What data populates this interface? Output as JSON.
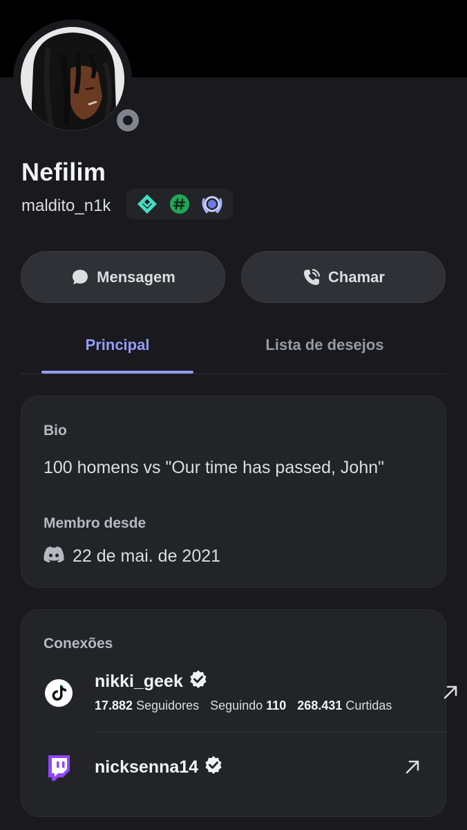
{
  "profile": {
    "display_name": "Nefilim",
    "username": "maldito_n1k",
    "status": "offline",
    "badges": [
      "hypesquad-balance-icon",
      "active-developer-icon",
      "quest-badge-icon"
    ]
  },
  "actions": {
    "message_label": "Mensagem",
    "call_label": "Chamar"
  },
  "tabs": [
    {
      "label": "Principal",
      "active": true
    },
    {
      "label": "Lista de desejos",
      "active": false
    }
  ],
  "bio": {
    "label": "Bio",
    "text": "100 homens vs \"Our time has passed, John\"",
    "member_since_label": "Membro desde",
    "member_since_date": "22 de mai. de 2021"
  },
  "connections": {
    "label": "Conexões",
    "items": [
      {
        "service": "tiktok",
        "icon": "tiktok-icon",
        "name": "nikki_geek",
        "verified": true,
        "stats": {
          "followers_value": "17.882",
          "followers_label": "Seguidores",
          "following_label": "Seguindo",
          "following_value": "110",
          "likes_value": "268.431",
          "likes_label": "Curtidas"
        }
      },
      {
        "service": "twitch",
        "icon": "twitch-icon",
        "name": "nicksenna14",
        "verified": true
      }
    ]
  },
  "colors": {
    "accent": "#949cf7",
    "background": "#1a1a1e",
    "card": "#232428",
    "twitch": "#9146ff"
  }
}
